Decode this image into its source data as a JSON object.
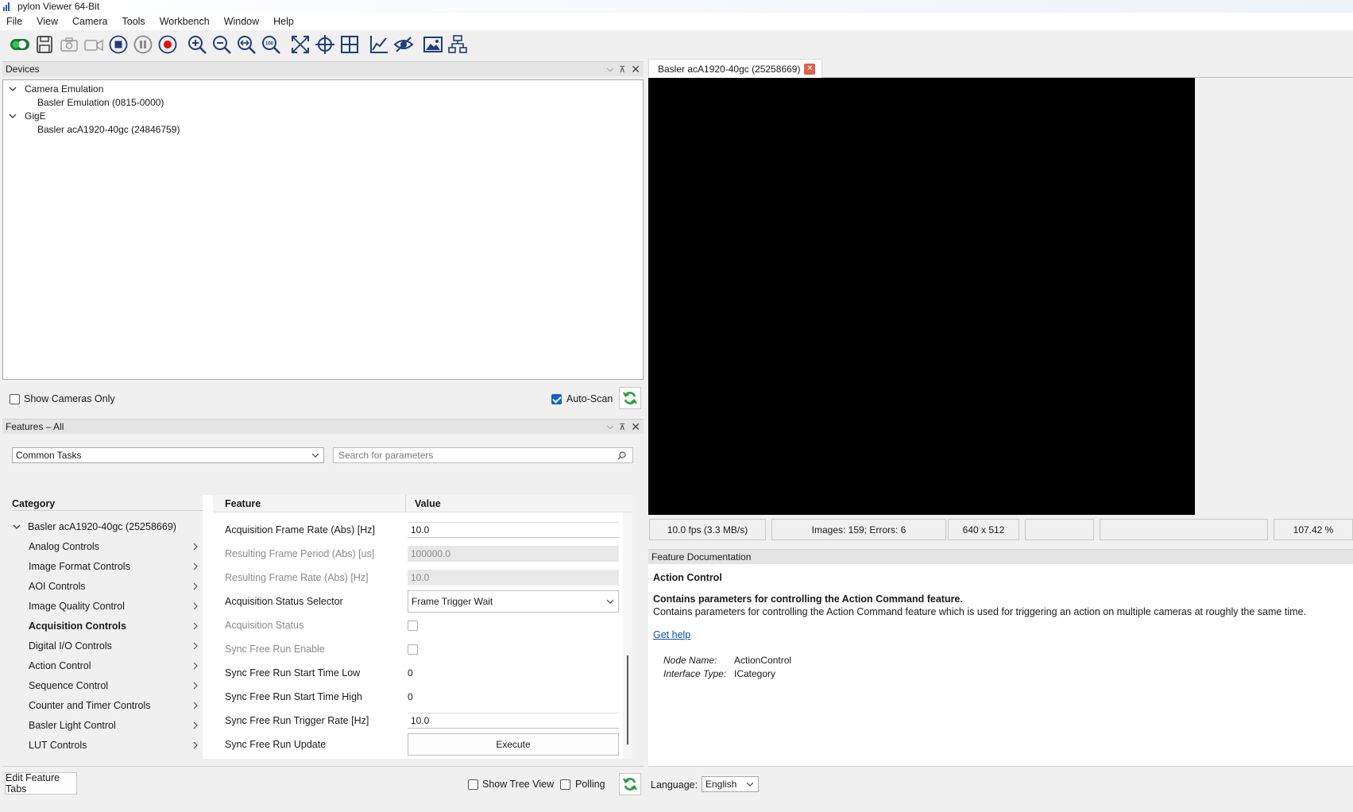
{
  "app": {
    "title": "pylon Viewer 64-Bit"
  },
  "menu": [
    "File",
    "View",
    "Camera",
    "Tools",
    "Workbench",
    "Window",
    "Help"
  ],
  "toolbar": {
    "icons": [
      "connect-toggle-icon",
      "save-icon",
      "single-shot-icon",
      "continuous-shot-icon",
      "stop-icon",
      "pause-icon",
      "record-icon",
      "zoom-in-icon",
      "zoom-out-icon",
      "zoom-fit-icon",
      "zoom-100-icon",
      "fullscreen-icon",
      "crosshair-icon",
      "grid-icon",
      "histogram-icon",
      "hide-icon",
      "image-icon",
      "settings-tree-icon"
    ],
    "zoom100_text": "100"
  },
  "devices": {
    "header": "Devices",
    "tree": [
      {
        "label": "Camera Emulation",
        "children": [
          "Basler Emulation (0815-0000)"
        ]
      },
      {
        "label": "GigE",
        "children": [
          "Basler acA1920-40gc (24846759)"
        ]
      }
    ],
    "show_cameras_only_label": "Show Cameras Only",
    "show_cameras_only_checked": false,
    "auto_scan_label": "Auto-Scan",
    "auto_scan_checked": true
  },
  "features": {
    "header": "Features – All",
    "view_select": "Common Tasks",
    "search_placeholder": "Search for parameters",
    "category_header": "Category",
    "feature_header": "Feature",
    "value_header": "Value",
    "camera_node": "Basler acA1920-40gc (25258669)",
    "categories": [
      "Analog Controls",
      "Image Format Controls",
      "AOI Controls",
      "Image Quality Control",
      "Acquisition Controls",
      "Digital I/O Controls",
      "Action Control",
      "Sequence Control",
      "Counter and Timer Controls",
      "Basler Light Control",
      "LUT Controls"
    ],
    "selected_category": "Acquisition Controls",
    "rows": [
      {
        "label": "Acquisition Frame Rate (Abs) [Hz]",
        "value": "10.0",
        "kind": "edit",
        "enabled": true
      },
      {
        "label": "Resulting Frame Period (Abs) [us]",
        "value": "100000.0",
        "kind": "readonly",
        "enabled": false
      },
      {
        "label": "Resulting Frame Rate (Abs) [Hz]",
        "value": "10.0",
        "kind": "readonly",
        "enabled": false
      },
      {
        "label": "Acquisition Status Selector",
        "value": "Frame Trigger Wait",
        "kind": "select",
        "enabled": true
      },
      {
        "label": "Acquisition Status",
        "value": "",
        "kind": "checkbox",
        "enabled": false
      },
      {
        "label": "Sync Free Run Enable",
        "value": "",
        "kind": "checkbox",
        "enabled": false
      },
      {
        "label": "Sync Free Run Start Time Low",
        "value": "0",
        "kind": "text",
        "enabled": true
      },
      {
        "label": "Sync Free Run Start Time High",
        "value": "0",
        "kind": "text",
        "enabled": true
      },
      {
        "label": "Sync Free Run Trigger Rate [Hz]",
        "value": "10.0",
        "kind": "edit",
        "enabled": true
      },
      {
        "label": "Sync Free Run Update",
        "value": "Execute",
        "kind": "button",
        "enabled": true
      }
    ],
    "edit_tabs_label": "Edit Feature Tabs",
    "show_tree_view_label": "Show Tree View",
    "show_tree_view_checked": false,
    "polling_label": "Polling",
    "polling_checked": false
  },
  "image_view": {
    "tab_label": "Basler acA1920-40gc (25258669)",
    "status": {
      "fps": "10.0 fps (3.3 MB/s)",
      "images": "Images: 159; Errors: 6",
      "size": "640 x 512",
      "empty1": "",
      "empty2": "",
      "zoom": "107.42 %"
    }
  },
  "documentation": {
    "header": "Feature Documentation",
    "title": "Action Control",
    "summary": "Contains parameters for controlling the Action Command feature.",
    "description": "Contains parameters for controlling the Action Command feature which is used for triggering an action on multiple cameras at roughly the same time.",
    "help_link": "Get help",
    "node_name_label": "Node Name:",
    "node_name": "ActionControl",
    "interface_label": "Interface Type:",
    "interface": "ICategory"
  },
  "language": {
    "label": "Language:",
    "value": "English"
  },
  "colors": {
    "accent": "#1560c8",
    "refresh_green": "#2e9e3e",
    "record_red": "#e01010",
    "close_tab_red": "#e0604a"
  }
}
